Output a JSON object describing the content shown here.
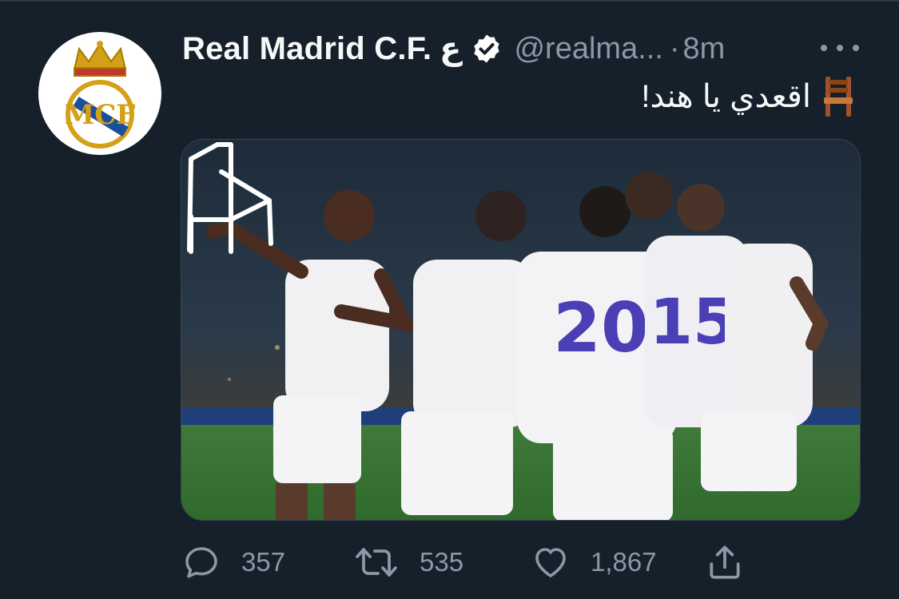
{
  "tweet": {
    "display_name": "Real Madrid C.F.",
    "name_suffix": "ع",
    "handle": "@realma...",
    "separator": "·",
    "time": "8m",
    "text": "اقعدي يا هند!",
    "emoji": "chair-emoji"
  },
  "actions": {
    "replies": "357",
    "retweets": "535",
    "likes": "1,867"
  },
  "media": {
    "description_icon": "photo"
  },
  "colors": {
    "background": "#15202b",
    "text_primary": "#f7f9f9",
    "text_secondary": "#8b98a5",
    "verified": "#ffffff"
  }
}
